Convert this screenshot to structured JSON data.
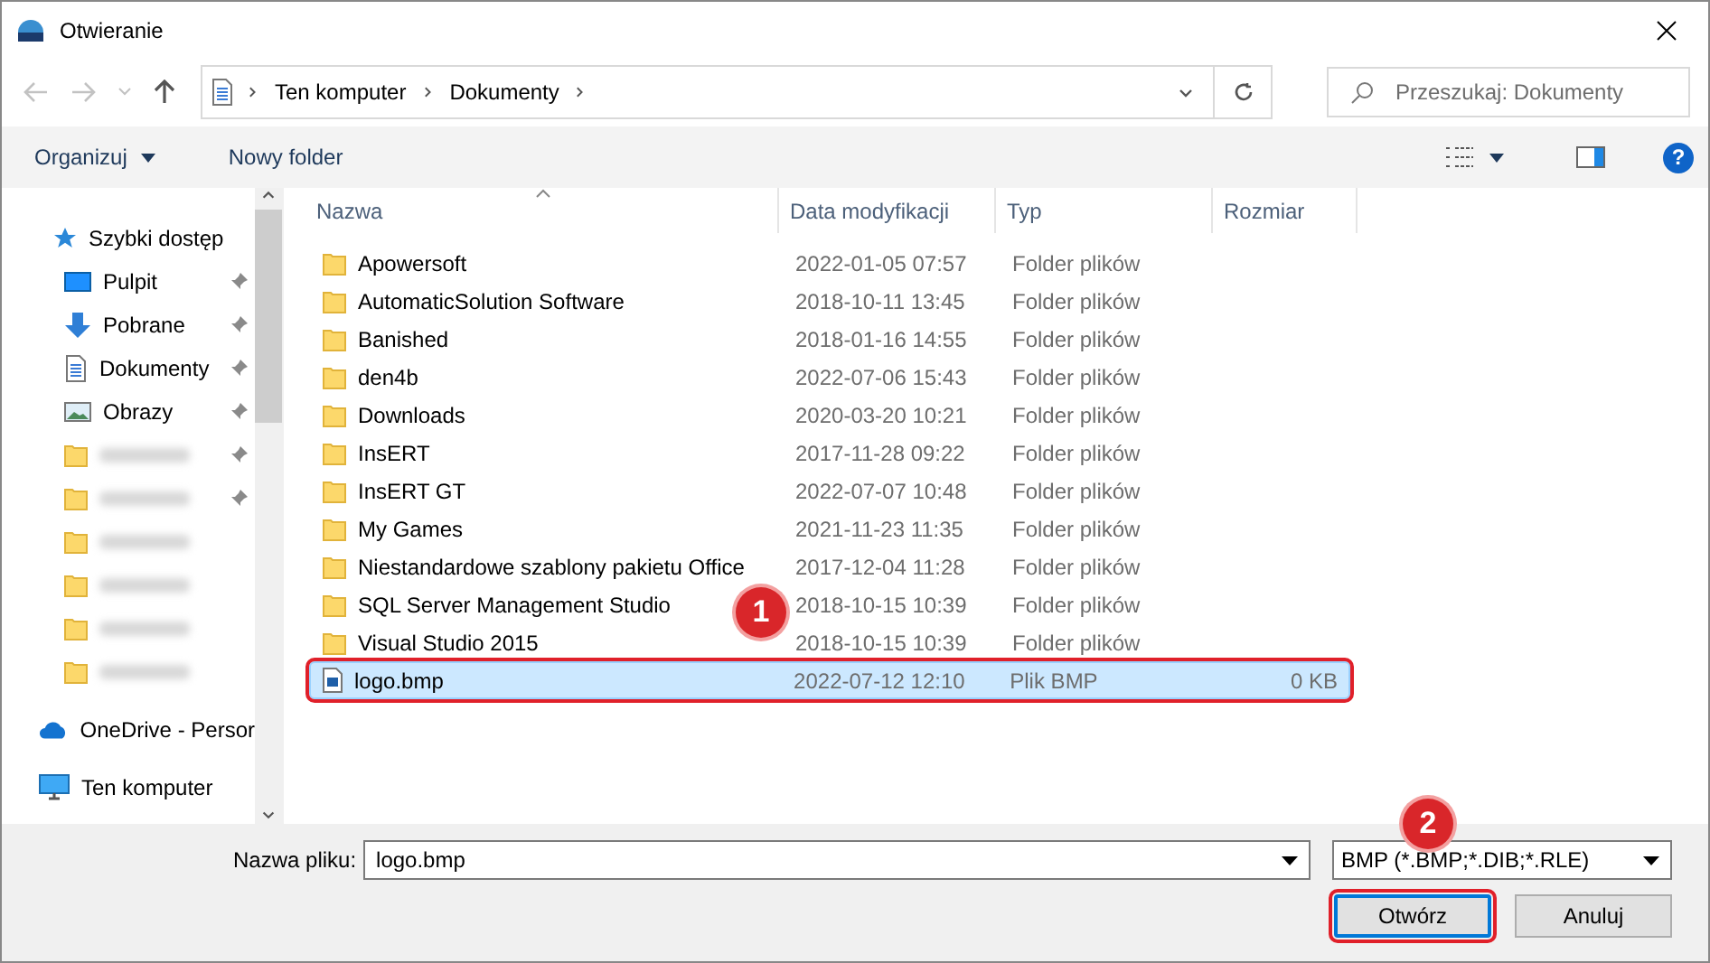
{
  "window": {
    "title": "Otwieranie"
  },
  "address": {
    "segments": [
      "Ten komputer",
      "Dokumenty"
    ]
  },
  "search": {
    "placeholder": "Przeszukaj: Dokumenty"
  },
  "toolbar": {
    "organize": "Organizuj",
    "new_folder": "Nowy folder",
    "help": "?"
  },
  "sidebar": {
    "items": [
      {
        "kind": "star",
        "label": "Szybki dostęp",
        "children": [
          {
            "kind": "desktop",
            "label": "Pulpit",
            "pinned": true
          },
          {
            "kind": "download",
            "label": "Pobrane",
            "pinned": true
          },
          {
            "kind": "document",
            "label": "Dokumenty",
            "pinned": true
          },
          {
            "kind": "pictures",
            "label": "Obrazy",
            "pinned": true
          },
          {
            "kind": "blurred",
            "pinned": true
          },
          {
            "kind": "blurred",
            "pinned": true
          },
          {
            "kind": "blurred",
            "pinned": false
          },
          {
            "kind": "blurred",
            "pinned": false
          },
          {
            "kind": "blurred",
            "pinned": false
          },
          {
            "kind": "blurred",
            "pinned": false
          }
        ]
      },
      {
        "kind": "cloud",
        "label": "OneDrive - Persor"
      },
      {
        "kind": "computer",
        "label": "Ten komputer"
      }
    ]
  },
  "table": {
    "columns": [
      "Nazwa",
      "Data modyfikacji",
      "Typ",
      "Rozmiar"
    ],
    "rows": [
      {
        "kind": "folder",
        "name": "Apowersoft",
        "date": "2022-01-05 07:57",
        "type": "Folder plików",
        "selected": false,
        "highlighted": false
      },
      {
        "kind": "folder",
        "name": "AutomaticSolution Software",
        "date": "2018-10-11 13:45",
        "type": "Folder plików",
        "selected": false,
        "highlighted": false
      },
      {
        "kind": "folder",
        "name": "Banished",
        "date": "2018-01-16 14:55",
        "type": "Folder plików",
        "selected": false,
        "highlighted": false
      },
      {
        "kind": "folder",
        "name": "den4b",
        "date": "2022-07-06 15:43",
        "type": "Folder plików",
        "selected": false,
        "highlighted": false
      },
      {
        "kind": "folder",
        "name": "Downloads",
        "date": "2020-03-20 10:21",
        "type": "Folder plików",
        "selected": false,
        "highlighted": false
      },
      {
        "kind": "folder",
        "name": "InsERT",
        "date": "2017-11-28 09:22",
        "type": "Folder plików",
        "selected": false,
        "highlighted": false
      },
      {
        "kind": "folder",
        "name": "InsERT GT",
        "date": "2022-07-07 10:48",
        "type": "Folder plików",
        "selected": false,
        "highlighted": false
      },
      {
        "kind": "folder",
        "name": "My Games",
        "date": "2021-11-23 11:35",
        "type": "Folder plików",
        "selected": false,
        "highlighted": false
      },
      {
        "kind": "folder",
        "name": "Niestandardowe szablony pakietu Office",
        "date": "2017-12-04 11:28",
        "type": "Folder plików",
        "selected": false,
        "highlighted": false
      },
      {
        "kind": "folder",
        "name": "SQL Server Management Studio",
        "date": "2018-10-15 10:39",
        "type": "Folder plików",
        "selected": false,
        "highlighted": false
      },
      {
        "kind": "folder",
        "name": "Visual Studio 2015",
        "date": "2018-10-15 10:39",
        "type": "Folder plików",
        "selected": false,
        "highlighted": false
      },
      {
        "kind": "image",
        "name": "logo.bmp",
        "date": "2022-07-12 12:10",
        "type": "Plik BMP",
        "size": "0 KB",
        "selected": true,
        "highlighted": true
      }
    ]
  },
  "bottom": {
    "filename_label": "Nazwa pliku:",
    "filename": "logo.bmp",
    "filter": "BMP (*.BMP;*.DIB;*.RLE)",
    "buttons": [
      {
        "label": "Otwórz",
        "kind": "default",
        "highlighted": true
      },
      {
        "label": "Anuluj",
        "kind": "normal",
        "highlighted": false
      }
    ]
  },
  "annotations": [
    {
      "label": "1"
    },
    {
      "label": "2"
    }
  ]
}
